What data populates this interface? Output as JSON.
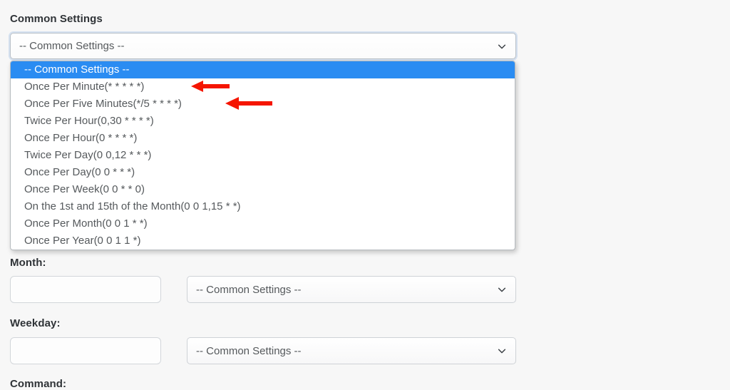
{
  "form": {
    "common_settings_label": "Common Settings",
    "month_label": "Month:",
    "weekday_label": "Weekday:",
    "command_label": "Command:"
  },
  "common_select": {
    "selected_value": "-- Common Settings --",
    "chevron_icon": "chevron-down-icon",
    "expanded": "true",
    "options": [
      "-- Common Settings --",
      "Once Per Minute(* * * * *)",
      "Once Per Five Minutes(*/5 * * * *)",
      "Twice Per Hour(0,30 * * * *)",
      "Once Per Hour(0 * * * *)",
      "Twice Per Day(0 0,12 * * *)",
      "Once Per Day(0 0 * * *)",
      "Once Per Week(0 0 * * 0)",
      "On the 1st and 15th of the Month(0 0 1,15 * *)",
      "Once Per Month(0 0 1 * *)",
      "Once Per Year(0 0 1 1 *)"
    ],
    "highlighted_index": 0
  },
  "month_row": {
    "input_value": "",
    "input_placeholder": "",
    "select_value": "-- Common Settings --",
    "chevron_icon": "chevron-down-icon"
  },
  "weekday_row": {
    "input_value": "",
    "input_placeholder": "",
    "select_value": "-- Common Settings --",
    "chevron_icon": "chevron-down-icon"
  },
  "annotations": [
    {
      "name": "red-arrow-once-per-minute",
      "icon": "arrow-left-icon",
      "color": "#f51500",
      "points_to": "Once Per Minute(* * * * *)"
    },
    {
      "name": "red-arrow-once-per-five-minutes",
      "icon": "arrow-left-icon",
      "color": "#f51500",
      "points_to": "Once Per Five Minutes(*/5 * * * *)"
    }
  ],
  "colors": {
    "page_background": "#f7f7f7",
    "highlight_blue": "#2a8cf2",
    "annotation_red": "#f51500",
    "label_text": "#2f3337",
    "option_text": "#55595c",
    "border_gray": "#ced2d6"
  }
}
